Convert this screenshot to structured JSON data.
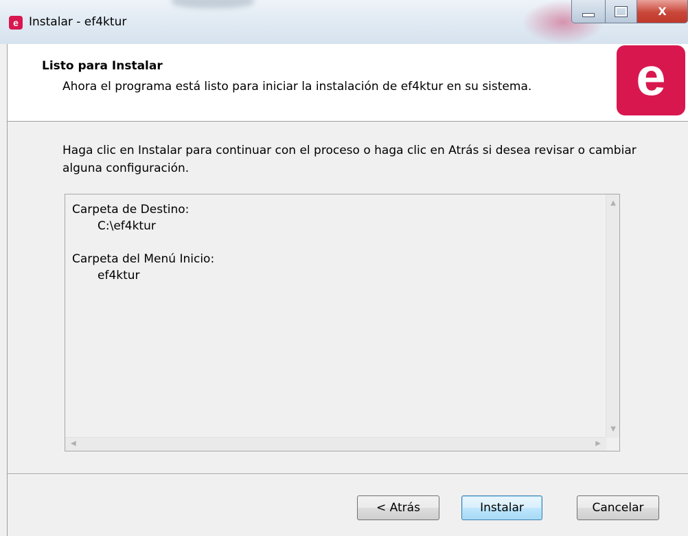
{
  "window": {
    "title": "Instalar - ef4ktur",
    "app_icon_letter": "e",
    "caption_close": "X"
  },
  "header": {
    "title": "Listo para Instalar",
    "subtitle": "Ahora el programa está listo para iniciar la instalación de ef4ktur en su sistema.",
    "logo_letter": "e"
  },
  "intro": {
    "text": "Haga clic en Instalar para continuar con el proceso o haga clic en Atrás si desea revisar o cambiar alguna configuración."
  },
  "summary": {
    "dest_label": "Carpeta de Destino:",
    "dest_value": "C:\\ef4ktur",
    "menu_label": "Carpeta del Menú Inicio:",
    "menu_value": "ef4ktur"
  },
  "buttons": {
    "back": "< Atrás",
    "install": "Instalar",
    "cancel": "Cancelar"
  },
  "colors": {
    "brand": "#d8174f",
    "default_button_border": "#3c7fb1"
  },
  "icons": {
    "app": "ef4ktur-app-icon",
    "logo": "ef4ktur-logo"
  }
}
